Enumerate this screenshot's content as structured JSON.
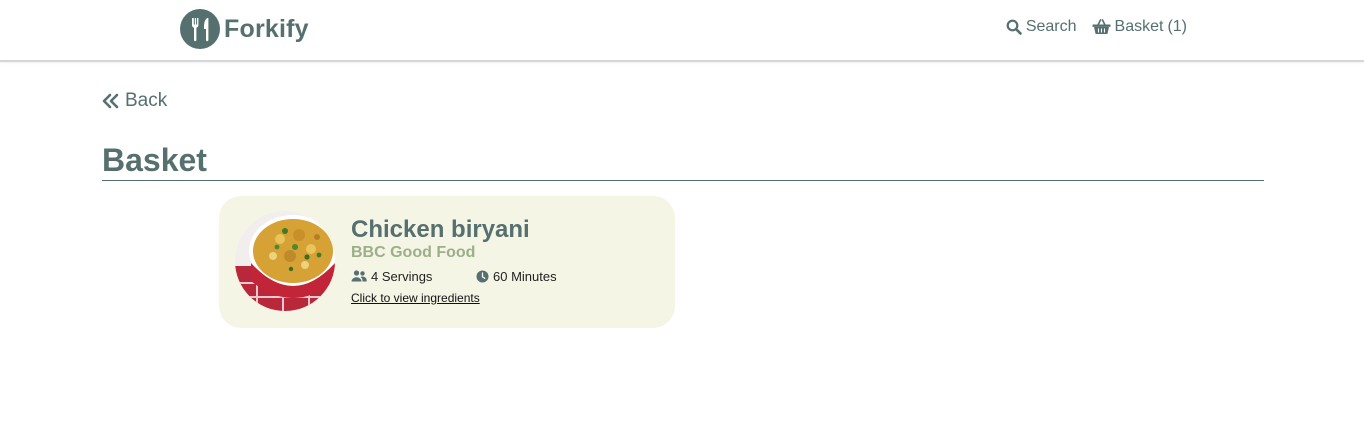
{
  "header": {
    "brand_name": "Forkify",
    "logo_icon": "fork-knife-icon",
    "nav": {
      "search_label": "Search",
      "basket_label": "Basket",
      "basket_count": "(1)"
    }
  },
  "back": {
    "label": "Back",
    "icon": "double-chevron-left-icon"
  },
  "page": {
    "title": "Basket"
  },
  "basket": {
    "items": [
      {
        "title": "Chicken biryani",
        "source": "BBC Good Food",
        "servings": "4 Servings",
        "time": "60 Minutes",
        "link_label": "Click to view ingredients"
      }
    ]
  },
  "colors": {
    "primary": "#55706f",
    "accent": "#9caf88",
    "card_background": "#f5f5e6"
  }
}
